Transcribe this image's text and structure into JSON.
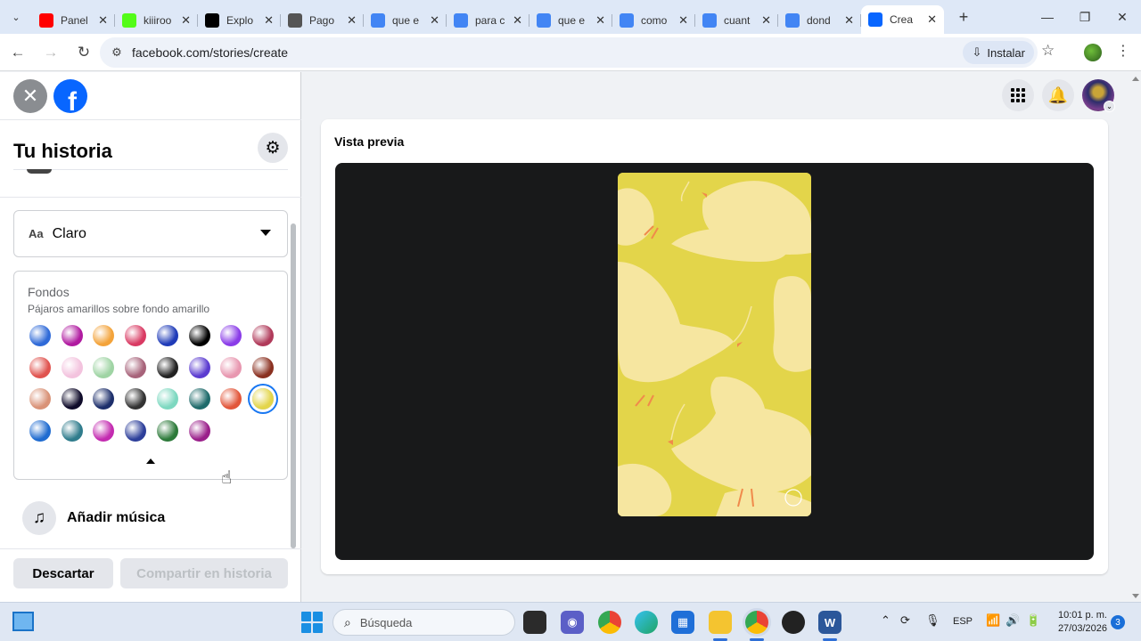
{
  "browser": {
    "tabs": [
      {
        "label": "Panel",
        "icon": "youtube-icon",
        "color": "#ff0000"
      },
      {
        "label": "kiiiroo",
        "icon": "kick-icon",
        "color": "#53fc18"
      },
      {
        "label": "Explo",
        "icon": "tiktok-icon",
        "color": "#000000"
      },
      {
        "label": "Pago",
        "icon": "openai-icon",
        "color": "#555555"
      },
      {
        "label": "que e",
        "icon": "google-icon",
        "color": "#4285f4"
      },
      {
        "label": "para c",
        "icon": "google-icon",
        "color": "#4285f4"
      },
      {
        "label": "que e",
        "icon": "google-icon",
        "color": "#4285f4"
      },
      {
        "label": "como",
        "icon": "google-icon",
        "color": "#4285f4"
      },
      {
        "label": "cuant",
        "icon": "google-icon",
        "color": "#4285f4"
      },
      {
        "label": "dond",
        "icon": "google-icon",
        "color": "#4285f4"
      },
      {
        "label": "Crea",
        "icon": "facebook-icon",
        "color": "#0866ff",
        "active": true
      }
    ],
    "url": "facebook.com/stories/create",
    "install_label": "Instalar"
  },
  "panel": {
    "title": "Tu historia",
    "font_select_value": "Claro",
    "backgrounds_label": "Fondos",
    "backgrounds_selected": "Pájaros amarillos sobre fondo amarillo",
    "swatches": [
      "#2f6ad8",
      "#b01aa0",
      "#f3a33a",
      "#d93a63",
      "#1f3bb8",
      "#000000",
      "#8a3ce8",
      "#b03a5a",
      "#e0534f",
      "#f3c3de",
      "#9fd4a4",
      "#a7637a",
      "#222222",
      "#5b3bd0",
      "#e897b0",
      "#8a3020",
      "#d99277",
      "#0f0b2a",
      "#1d2f6b",
      "#333333",
      "#7dd8c0",
      "#1f6b6b",
      "#e2563a",
      "#e3d54a",
      "#1f6bd0",
      "#2f7c8c",
      "#c32bb0",
      "#2d3f9a",
      "#2d7a3a",
      "#9a1f8a"
    ],
    "selected_swatch_index": 23,
    "music_label": "Añadir música",
    "discard_label": "Descartar",
    "share_label": "Compartir en historia"
  },
  "preview": {
    "title": "Vista previa"
  },
  "taskbar": {
    "search_placeholder": "Búsqueda",
    "language": "ESP",
    "time": "10:01 p. m.",
    "date": "27/03/2026",
    "notifications": "3"
  }
}
